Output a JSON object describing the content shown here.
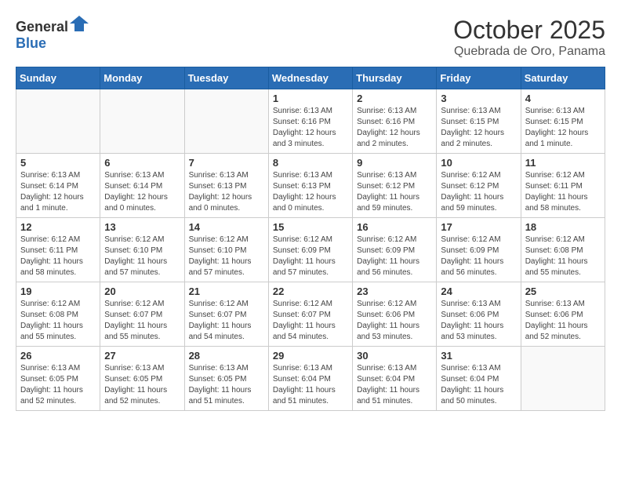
{
  "logo": {
    "general": "General",
    "blue": "Blue"
  },
  "header": {
    "month": "October 2025",
    "location": "Quebrada de Oro, Panama"
  },
  "weekdays": [
    "Sunday",
    "Monday",
    "Tuesday",
    "Wednesday",
    "Thursday",
    "Friday",
    "Saturday"
  ],
  "weeks": [
    [
      {
        "day": "",
        "info": ""
      },
      {
        "day": "",
        "info": ""
      },
      {
        "day": "",
        "info": ""
      },
      {
        "day": "1",
        "info": "Sunrise: 6:13 AM\nSunset: 6:16 PM\nDaylight: 12 hours and 3 minutes."
      },
      {
        "day": "2",
        "info": "Sunrise: 6:13 AM\nSunset: 6:16 PM\nDaylight: 12 hours and 2 minutes."
      },
      {
        "day": "3",
        "info": "Sunrise: 6:13 AM\nSunset: 6:15 PM\nDaylight: 12 hours and 2 minutes."
      },
      {
        "day": "4",
        "info": "Sunrise: 6:13 AM\nSunset: 6:15 PM\nDaylight: 12 hours and 1 minute."
      }
    ],
    [
      {
        "day": "5",
        "info": "Sunrise: 6:13 AM\nSunset: 6:14 PM\nDaylight: 12 hours and 1 minute."
      },
      {
        "day": "6",
        "info": "Sunrise: 6:13 AM\nSunset: 6:14 PM\nDaylight: 12 hours and 0 minutes."
      },
      {
        "day": "7",
        "info": "Sunrise: 6:13 AM\nSunset: 6:13 PM\nDaylight: 12 hours and 0 minutes."
      },
      {
        "day": "8",
        "info": "Sunrise: 6:13 AM\nSunset: 6:13 PM\nDaylight: 12 hours and 0 minutes."
      },
      {
        "day": "9",
        "info": "Sunrise: 6:13 AM\nSunset: 6:12 PM\nDaylight: 11 hours and 59 minutes."
      },
      {
        "day": "10",
        "info": "Sunrise: 6:12 AM\nSunset: 6:12 PM\nDaylight: 11 hours and 59 minutes."
      },
      {
        "day": "11",
        "info": "Sunrise: 6:12 AM\nSunset: 6:11 PM\nDaylight: 11 hours and 58 minutes."
      }
    ],
    [
      {
        "day": "12",
        "info": "Sunrise: 6:12 AM\nSunset: 6:11 PM\nDaylight: 11 hours and 58 minutes."
      },
      {
        "day": "13",
        "info": "Sunrise: 6:12 AM\nSunset: 6:10 PM\nDaylight: 11 hours and 57 minutes."
      },
      {
        "day": "14",
        "info": "Sunrise: 6:12 AM\nSunset: 6:10 PM\nDaylight: 11 hours and 57 minutes."
      },
      {
        "day": "15",
        "info": "Sunrise: 6:12 AM\nSunset: 6:09 PM\nDaylight: 11 hours and 57 minutes."
      },
      {
        "day": "16",
        "info": "Sunrise: 6:12 AM\nSunset: 6:09 PM\nDaylight: 11 hours and 56 minutes."
      },
      {
        "day": "17",
        "info": "Sunrise: 6:12 AM\nSunset: 6:09 PM\nDaylight: 11 hours and 56 minutes."
      },
      {
        "day": "18",
        "info": "Sunrise: 6:12 AM\nSunset: 6:08 PM\nDaylight: 11 hours and 55 minutes."
      }
    ],
    [
      {
        "day": "19",
        "info": "Sunrise: 6:12 AM\nSunset: 6:08 PM\nDaylight: 11 hours and 55 minutes."
      },
      {
        "day": "20",
        "info": "Sunrise: 6:12 AM\nSunset: 6:07 PM\nDaylight: 11 hours and 55 minutes."
      },
      {
        "day": "21",
        "info": "Sunrise: 6:12 AM\nSunset: 6:07 PM\nDaylight: 11 hours and 54 minutes."
      },
      {
        "day": "22",
        "info": "Sunrise: 6:12 AM\nSunset: 6:07 PM\nDaylight: 11 hours and 54 minutes."
      },
      {
        "day": "23",
        "info": "Sunrise: 6:12 AM\nSunset: 6:06 PM\nDaylight: 11 hours and 53 minutes."
      },
      {
        "day": "24",
        "info": "Sunrise: 6:13 AM\nSunset: 6:06 PM\nDaylight: 11 hours and 53 minutes."
      },
      {
        "day": "25",
        "info": "Sunrise: 6:13 AM\nSunset: 6:06 PM\nDaylight: 11 hours and 52 minutes."
      }
    ],
    [
      {
        "day": "26",
        "info": "Sunrise: 6:13 AM\nSunset: 6:05 PM\nDaylight: 11 hours and 52 minutes."
      },
      {
        "day": "27",
        "info": "Sunrise: 6:13 AM\nSunset: 6:05 PM\nDaylight: 11 hours and 52 minutes."
      },
      {
        "day": "28",
        "info": "Sunrise: 6:13 AM\nSunset: 6:05 PM\nDaylight: 11 hours and 51 minutes."
      },
      {
        "day": "29",
        "info": "Sunrise: 6:13 AM\nSunset: 6:04 PM\nDaylight: 11 hours and 51 minutes."
      },
      {
        "day": "30",
        "info": "Sunrise: 6:13 AM\nSunset: 6:04 PM\nDaylight: 11 hours and 51 minutes."
      },
      {
        "day": "31",
        "info": "Sunrise: 6:13 AM\nSunset: 6:04 PM\nDaylight: 11 hours and 50 minutes."
      },
      {
        "day": "",
        "info": ""
      }
    ]
  ]
}
